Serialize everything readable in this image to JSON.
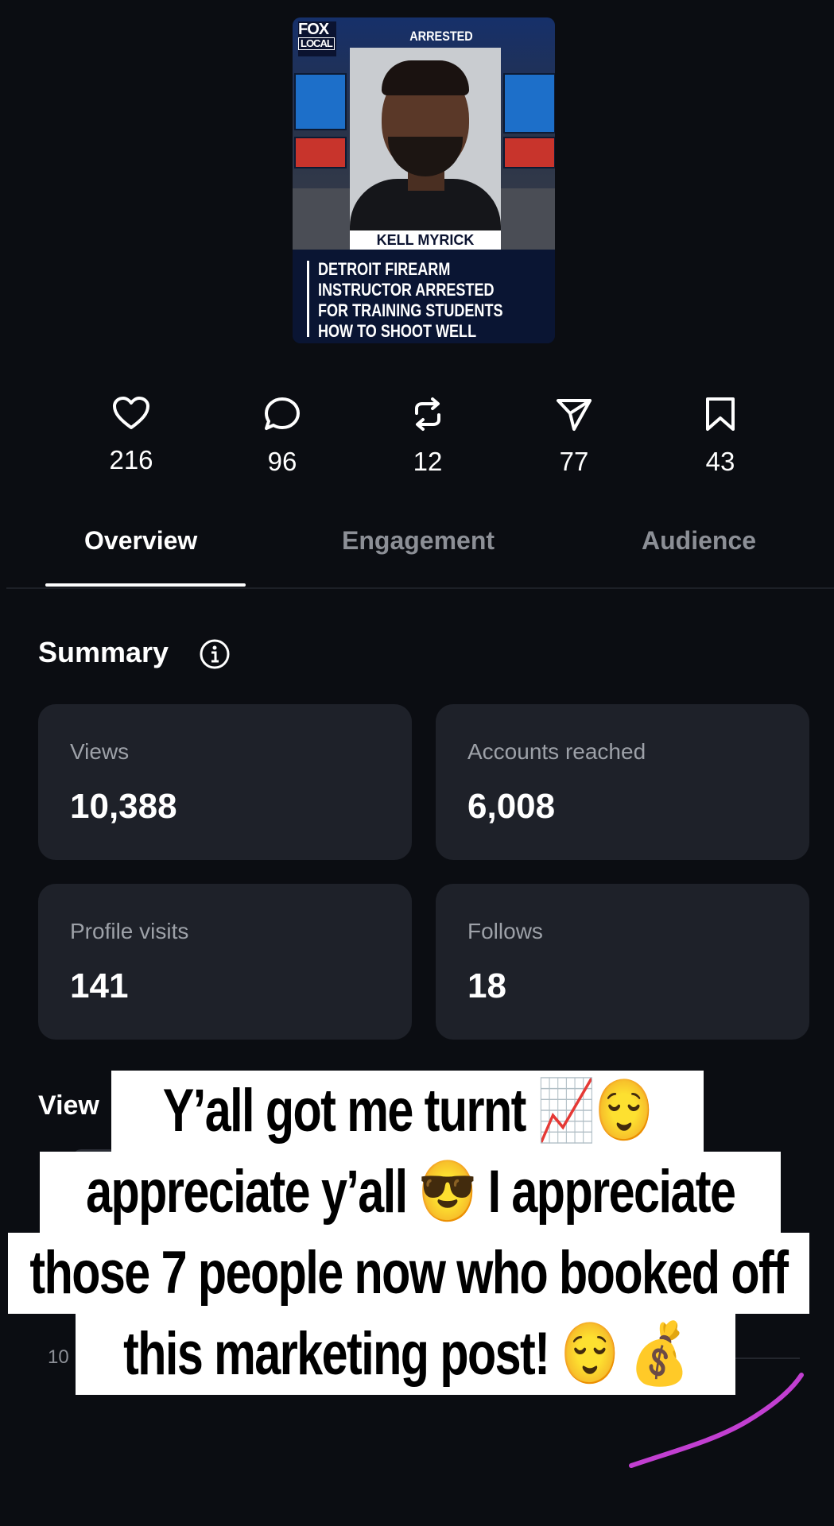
{
  "thumbnail": {
    "logo_line1": "FOX",
    "logo_line2": "LOCAL",
    "tag": "ARRESTED",
    "name": "KELL MYRICK",
    "headline_lines": [
      "DETROIT FIREARM",
      "INSTRUCTOR ARRESTED",
      "FOR TRAINING STUDENTS",
      "HOW TO SHOOT WELL"
    ]
  },
  "stats": [
    {
      "icon": "heart-icon",
      "value": "216"
    },
    {
      "icon": "comment-icon",
      "value": "96"
    },
    {
      "icon": "repost-icon",
      "value": "12"
    },
    {
      "icon": "share-icon",
      "value": "77"
    },
    {
      "icon": "bookmark-icon",
      "value": "43"
    }
  ],
  "tabs": {
    "overview": "Overview",
    "engagement": "Engagement",
    "audience": "Audience",
    "active": "Overview"
  },
  "summary": {
    "title": "Summary",
    "cards": [
      {
        "label": "Views",
        "value": "10,388"
      },
      {
        "label": "Accounts reached",
        "value": "6,008"
      },
      {
        "label": "Profile visits",
        "value": "141"
      },
      {
        "label": "Follows",
        "value": "18"
      }
    ]
  },
  "views_section": {
    "heading_visible": "View",
    "axis_tick": "10"
  },
  "caption": {
    "line1": "Y’all got me turnt 📈😌",
    "line2": "appreciate y’all 😎 I appreciate",
    "line3": "those 7 people now who booked off",
    "line4": "this marketing post! 😌 💰"
  },
  "colors": {
    "background": "#0b0d12",
    "card": "#1e2129",
    "muted_text": "#9da1a8",
    "chart_line": "#c23fd1",
    "caption_bg": "#ffffff"
  }
}
